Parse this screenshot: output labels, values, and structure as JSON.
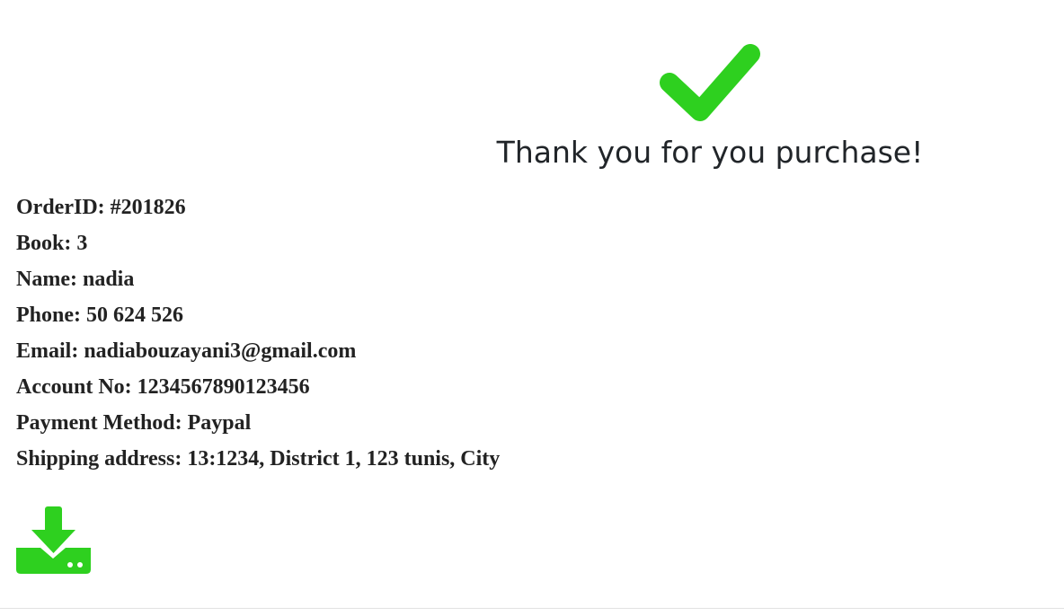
{
  "heading": "Thank you for you purchase!",
  "order": {
    "order_id": "OrderID: #201826",
    "book": "Book: 3",
    "name": "Name: nadia",
    "phone": "Phone: 50 624 526",
    "email": "Email: nadiabouzayani3@gmail.com",
    "account": "Account No: 1234567890123456",
    "payment": "Payment Method: Paypal",
    "shipping": "Shipping address: 13:1234, District 1, 123 tunis, City"
  },
  "icons": {
    "success": "check-icon",
    "download": "download-icon"
  },
  "colors": {
    "accent_green": "#2ed01f",
    "text": "#212529"
  }
}
